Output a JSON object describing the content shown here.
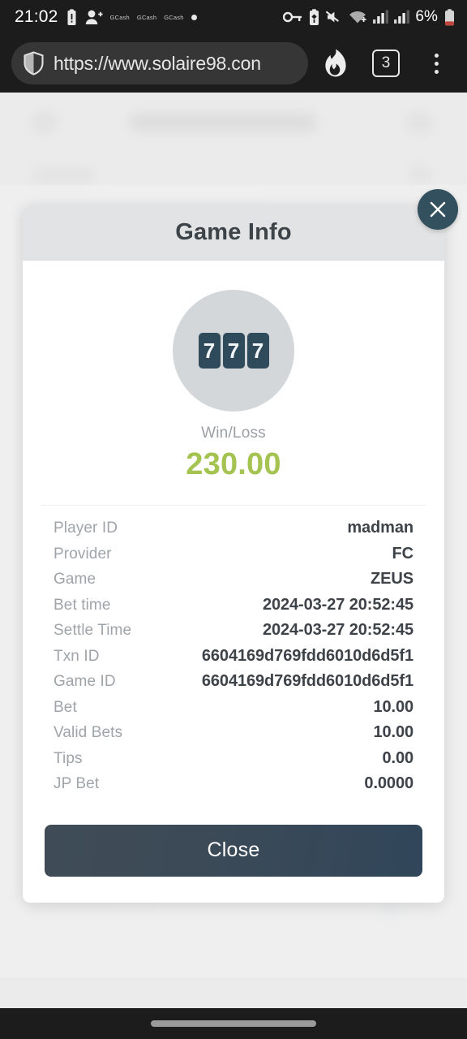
{
  "status_bar": {
    "clock": "21:02",
    "battery_percent": "6%",
    "notification_chips": [
      "GCash",
      "GCash",
      "GCash"
    ],
    "icons": [
      "battery-alert-icon",
      "person-add-icon",
      "dot-icon",
      "vpn-key-icon",
      "battery-saver-icon",
      "volume-mute-icon",
      "wifi-icon",
      "signal-bars-icon",
      "signal-bars-icon",
      "battery-low-icon"
    ]
  },
  "browser": {
    "url": "https://www.solaire98.con",
    "shield_icon": "shield-icon",
    "flame_icon": "flame-icon",
    "tab_count": "3",
    "menu_icon": "kebab-menu-icon"
  },
  "modal": {
    "title": "Game Info",
    "close_icon": "close-icon",
    "slot_icon": {
      "name": "slot-777-icon",
      "digits": [
        "7",
        "7",
        "7"
      ]
    },
    "winloss_label": "Win/Loss",
    "winloss_value": "230.00",
    "winloss_color": "#a4c350",
    "details": [
      {
        "label": "Player ID",
        "value": "madman"
      },
      {
        "label": "Provider",
        "value": "FC"
      },
      {
        "label": "Game",
        "value": "ZEUS"
      },
      {
        "label": "Bet time",
        "value": "2024-03-27 20:52:45"
      },
      {
        "label": "Settle Time",
        "value": "2024-03-27 20:52:45"
      },
      {
        "label": "Txn ID",
        "value": "6604169d769fdd6010d6d5f1"
      },
      {
        "label": "Game ID",
        "value": "6604169d769fdd6010d6d5f1"
      },
      {
        "label": "Bet",
        "value": "10.00"
      },
      {
        "label": "Valid Bets",
        "value": "10.00"
      },
      {
        "label": "Tips",
        "value": "0.00"
      },
      {
        "label": "JP Bet",
        "value": "0.0000"
      }
    ],
    "close_button_label": "Close",
    "accent_dark": "#33505f"
  },
  "nav_bar": {
    "pill": "gesture-pill"
  }
}
